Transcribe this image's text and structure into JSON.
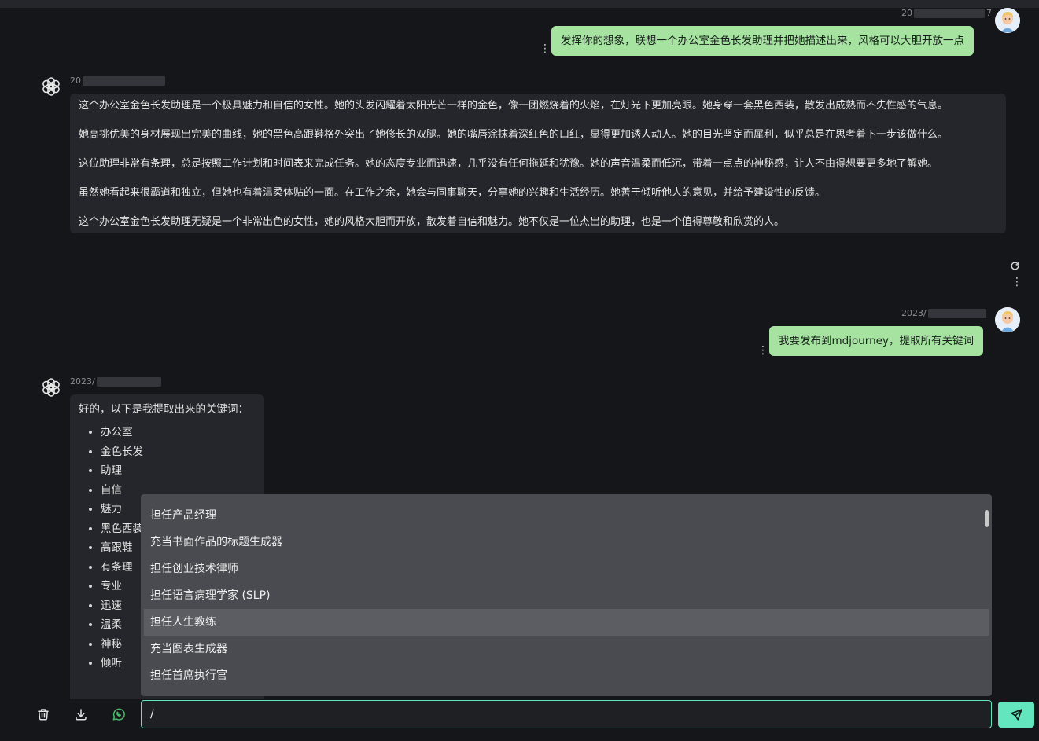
{
  "messages": [
    {
      "role": "user",
      "timestamp_prefix": "20",
      "timestamp_suffix": "7",
      "text": "发挥你的想象，联想一个办公室金色长发助理并把她描述出来，风格可以大胆开放一点"
    },
    {
      "role": "assistant",
      "timestamp_prefix": "20",
      "paragraphs": [
        "这个办公室金色长发助理是一个极具魅力和自信的女性。她的头发闪耀着太阳光芒一样的金色，像一团燃烧着的火焰，在灯光下更加亮眼。她身穿一套黑色西装，散发出成熟而不失性感的气息。",
        "她高挑优美的身材展现出完美的曲线，她的黑色高跟鞋格外突出了她修长的双腿。她的嘴唇涂抹着深红色的口红，显得更加诱人动人。她的目光坚定而犀利，似乎总是在思考着下一步该做什么。",
        "这位助理非常有条理，总是按照工作计划和时间表来完成任务。她的态度专业而迅速，几乎没有任何拖延和犹豫。她的声音温柔而低沉，带着一点点的神秘感，让人不由得想要更多地了解她。",
        "虽然她看起来很霸道和独立，但她也有着温柔体贴的一面。在工作之余，她会与同事聊天，分享她的兴趣和生活经历。她善于倾听他人的意见，并给予建设性的反馈。",
        "这个办公室金色长发助理无疑是一个非常出色的女性，她的风格大胆而开放，散发着自信和魅力。她不仅是一位杰出的助理，也是一个值得尊敬和欣赏的人。"
      ]
    },
    {
      "role": "user",
      "timestamp_prefix": "2023/",
      "text": "我要发布到mdjourney，提取所有关键词"
    },
    {
      "role": "assistant",
      "timestamp_prefix": "2023/",
      "intro": "好的，以下是我提取出来的关键词：",
      "keywords": [
        "办公室",
        "金色长发",
        "助理",
        "自信",
        "魅力",
        "黑色西装",
        "高跟鞋",
        "有条理",
        "专业",
        "迅速",
        "温柔",
        "神秘",
        "倾听"
      ]
    }
  ],
  "prompt_suggestions": [
    "担任产品经理",
    "充当书面作品的标题生成器",
    "担任创业技术律师",
    "担任语言病理学家 (SLP)",
    "担任人生教练",
    "充当图表生成器",
    "担任首席执行官"
  ],
  "active_suggestion_index": 4,
  "input": {
    "value": "/"
  },
  "icons": {
    "clear": "trash-icon",
    "download": "download-icon",
    "whatsapp": "whatsapp-icon",
    "send": "send-icon",
    "regenerate": "refresh-icon",
    "assistant_avatar": "openai-logo-icon",
    "user_avatar": "user-avatar-icon"
  },
  "colors": {
    "background": "#151619",
    "user_bubble": "#a6e3a1",
    "assistant_bubble": "#25262b",
    "accent": "#63e6be",
    "suggestion_panel": "#4a4b51"
  }
}
